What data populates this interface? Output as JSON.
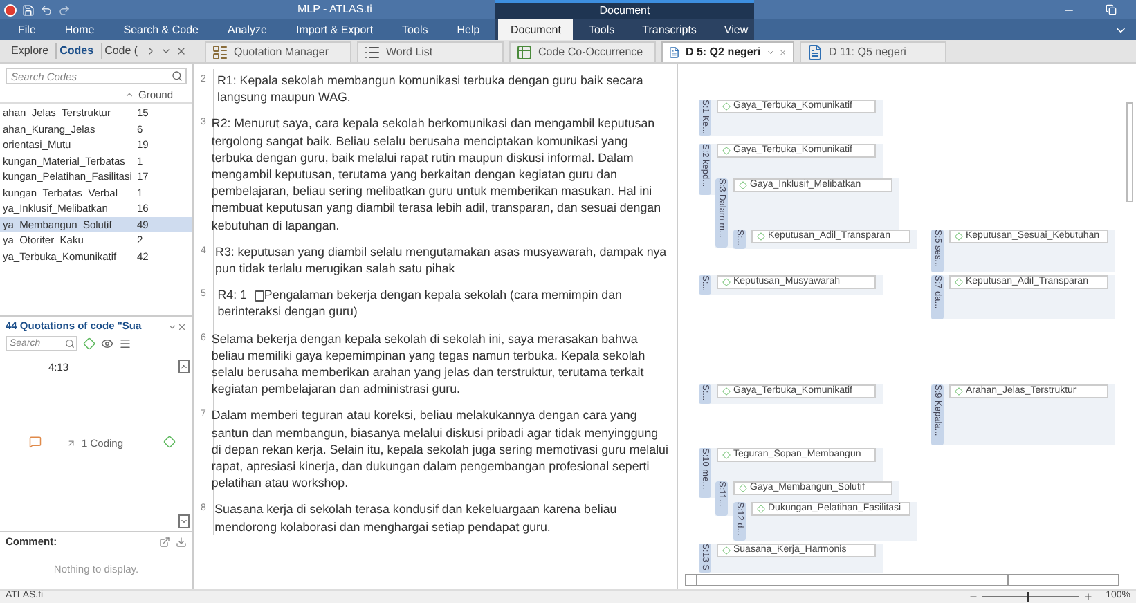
{
  "window": {
    "title": "MLP - ATLAS.ti",
    "context_title": "Document"
  },
  "ribbon_tabs": [
    {
      "label": "File",
      "kind": "main",
      "selected": false
    },
    {
      "label": "Home",
      "kind": "main",
      "selected": false
    },
    {
      "label": "Search & Code",
      "kind": "main",
      "selected": false
    },
    {
      "label": "Analyze",
      "kind": "main",
      "selected": false
    },
    {
      "label": "Import & Export",
      "kind": "main",
      "selected": false
    },
    {
      "label": "Tools",
      "kind": "main",
      "selected": false
    },
    {
      "label": "Help",
      "kind": "main",
      "selected": false
    },
    {
      "label": "Document",
      "kind": "contextual",
      "selected": true
    },
    {
      "label": "Tools",
      "kind": "contextual",
      "selected": false
    },
    {
      "label": "Transcripts",
      "kind": "contextual",
      "selected": false
    },
    {
      "label": "View",
      "kind": "contextual",
      "selected": false
    }
  ],
  "panel_tabs": [
    {
      "label": "Explore",
      "selected": false
    },
    {
      "label": "Codes",
      "selected": true
    },
    {
      "label": "Code (",
      "selected": false
    }
  ],
  "document_tabs": [
    {
      "label": "Quotation Manager",
      "kind": "manager",
      "selected": false
    },
    {
      "label": "Word List",
      "kind": "list",
      "selected": false
    },
    {
      "label": "Code Co-Occurrence",
      "kind": "table",
      "selected": false
    },
    {
      "label": "D 5: Q2 negeri",
      "kind": "document",
      "selected": true
    },
    {
      "label": "D 11: Q5 negeri",
      "kind": "document",
      "selected": false
    }
  ],
  "code_list": {
    "search_placeholder": "Search Codes",
    "column_header": "Ground",
    "rows": [
      {
        "name": "ahan_Jelas_Terstruktur",
        "count": "15",
        "selected": false
      },
      {
        "name": "ahan_Kurang_Jelas",
        "count": "6",
        "selected": false
      },
      {
        "name": "orientasi_Mutu",
        "count": "19",
        "selected": false
      },
      {
        "name": "kungan_Material_Terbatas",
        "count": "1",
        "selected": false
      },
      {
        "name": "kungan_Pelatihan_Fasilitasi",
        "count": "17",
        "selected": false
      },
      {
        "name": "kungan_Terbatas_Verbal",
        "count": "1",
        "selected": false
      },
      {
        "name": "ya_Inklusif_Melibatkan",
        "count": "16",
        "selected": false
      },
      {
        "name": "ya_Membangun_Solutif",
        "count": "49",
        "selected": true
      },
      {
        "name": "ya_Otoriter_Kaku",
        "count": "2",
        "selected": false
      },
      {
        "name": "ya_Terbuka_Komunikatif",
        "count": "42",
        "selected": false
      }
    ]
  },
  "quotations": {
    "title": "44 Quotations of code \"Sua",
    "search_placeholder": "Search",
    "quotation_id": "4:13",
    "codings": "1 Coding",
    "comment_label": "Comment:",
    "comment_empty": "Nothing to display."
  },
  "document": {
    "paragraphs": [
      {
        "number": "2",
        "text": "R1: Kepala sekolah membangun komunikasi terbuka dengan guru baik secara langsung maupun WAG."
      },
      {
        "number": "3",
        "text": "R2: Menurut saya, cara kepala sekolah berkomunikasi dan mengambil keputusan tergolong sangat baik. Beliau selalu berusaha menciptakan komunikasi yang terbuka dengan guru, baik melalui rapat rutin maupun diskusi informal. Dalam mengambil keputusan, terutama yang berkaitan dengan kegiatan guru dan pembelajaran, beliau sering melibatkan guru untuk memberikan masukan. Hal ini membuat keputusan yang diambil terasa lebih adil, transparan, dan sesuai dengan kebutuhan di lapangan."
      },
      {
        "number": "4",
        "text": "R3: keputusan yang diambil selalu mengutamakan asas musyawarah, dampak nya pun tidak terlalu merugikan salah satu pihak"
      },
      {
        "number": "5",
        "prefix": "R4: 1",
        "text": "Pengalaman bekerja dengan kepala sekolah (cara memimpin dan berinteraksi dengan guru)"
      },
      {
        "number": "6",
        "text": "Selama bekerja dengan kepala sekolah di sekolah ini, saya merasakan bahwa beliau memiliki gaya kepemimpinan yang tegas namun terbuka. Kepala sekolah selalu berusaha memberikan arahan yang jelas dan terstruktur, terutama terkait kegiatan pembelajaran dan administrasi guru."
      },
      {
        "number": "7",
        "text": "Dalam memberi teguran atau koreksi, beliau melakukannya dengan cara yang santun dan membangun, biasanya melalui diskusi pribadi agar tidak menyinggung di depan rekan kerja. Selain itu, kepala sekolah juga sering memotivasi guru melalui rapat, apresiasi kinerja, dan dukungan dalam pengembangan profesional seperti pelatihan atau workshop."
      },
      {
        "number": "8",
        "text": "Suasana kerja di sekolah terasa kondusif dan kekeluargaan karena beliau mendorong kolaborasi dan menghargai setiap pendapat guru."
      }
    ]
  },
  "margin": {
    "quotations": [
      {
        "label": "S:1 Ke...",
        "code": "Gaya_Terbuka_Komunikatif"
      },
      {
        "label": "S:2 kepd...",
        "code": "Gaya_Terbuka_Komunikatif"
      },
      {
        "label": "S:3 Dalam m...",
        "code": "Gaya_Inklusif_Melibatkan"
      },
      {
        "label": "S:...",
        "code": "Keputusan_Adil_Transparan"
      },
      {
        "label": "S:5 ses...",
        "code": "Keputusan_Sesuai_Kebutuhan"
      },
      {
        "label": "S:...",
        "code": "Keputusan_Musyawarah"
      },
      {
        "label": "S:7 da...",
        "code": "Keputusan_Adil_Transparan"
      },
      {
        "label": "S:...",
        "code": "Gaya_Terbuka_Komunikatif"
      },
      {
        "label": "S:9 Kepala...",
        "code": "Arahan_Jelas_Terstruktur"
      },
      {
        "label": "S:10 me...",
        "code": "Teguran_Sopan_Membangun"
      },
      {
        "label": "S:11...",
        "code": "Gaya_Membangun_Solutif"
      },
      {
        "label": "S:12 d...",
        "code": "Dukungan_Pelatihan_Fasilitasi"
      },
      {
        "label": "S:13 S",
        "code": "Suasana_Kerja_Harmonis"
      }
    ]
  },
  "status_bar": {
    "text": "ATLAS.ti",
    "zoom": "100%",
    "level": 0.45
  }
}
